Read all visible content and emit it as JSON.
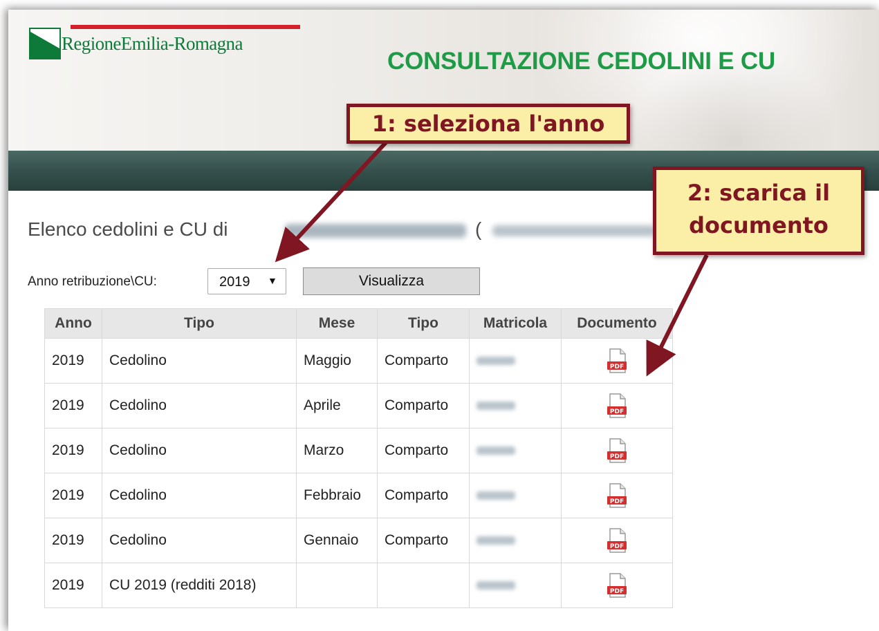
{
  "header": {
    "logo_text": "RegioneEmilia-Romagna",
    "app_title": "CONSULTAZIONE CEDOLINI E CU"
  },
  "content": {
    "list_title": "Elenco cedolini e CU di",
    "list_title_paren": "(",
    "filter_label": "Anno retribuzione\\CU:",
    "year_selected": "2019",
    "view_button": "Visualizza"
  },
  "table": {
    "headers": [
      "Anno",
      "Tipo",
      "Mese",
      "Tipo",
      "Matricola",
      "Documento"
    ],
    "rows": [
      {
        "anno": "2019",
        "tipo": "Cedolino",
        "mese": "Maggio",
        "tipo2": "Comparto"
      },
      {
        "anno": "2019",
        "tipo": "Cedolino",
        "mese": "Aprile",
        "tipo2": "Comparto"
      },
      {
        "anno": "2019",
        "tipo": "Cedolino",
        "mese": "Marzo",
        "tipo2": "Comparto"
      },
      {
        "anno": "2019",
        "tipo": "Cedolino",
        "mese": "Febbraio",
        "tipo2": "Comparto"
      },
      {
        "anno": "2019",
        "tipo": "Cedolino",
        "mese": "Gennaio",
        "tipo2": "Comparto"
      },
      {
        "anno": "2019",
        "tipo": "CU 2019 (redditi 2018)",
        "mese": "",
        "tipo2": ""
      }
    ]
  },
  "annotations": {
    "step1": "1: seleziona l'anno",
    "step2_line1": "2: scarica il",
    "step2_line2": "documento"
  },
  "colors": {
    "title_green": "#1f9a47",
    "navbar": "#344f4b",
    "callout_fill": "#fbeea6",
    "callout_border": "#7f1622",
    "pdf_red": "#d32f2f"
  },
  "icons": {
    "document": "pdf-icon",
    "dropdown": "chevron-down-icon"
  }
}
